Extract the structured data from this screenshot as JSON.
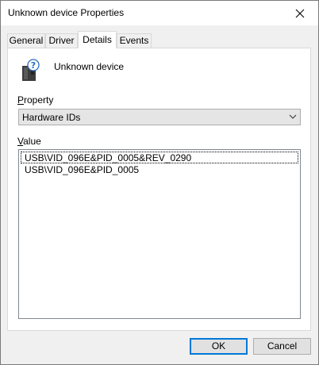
{
  "window": {
    "title": "Unknown device Properties"
  },
  "tabs": [
    {
      "label": "General"
    },
    {
      "label": "Driver"
    },
    {
      "label": "Details"
    },
    {
      "label": "Events"
    }
  ],
  "active_tab": "Details",
  "device": {
    "name": "Unknown device",
    "icon": "unknown-usb-device-icon"
  },
  "property": {
    "label_prefix": "",
    "label_underlined": "P",
    "label_rest": "roperty",
    "selected": "Hardware IDs"
  },
  "value": {
    "label_underlined": "V",
    "label_rest": "alue",
    "items": [
      "USB\\VID_096E&PID_0005&REV_0290",
      "USB\\VID_096E&PID_0005"
    ]
  },
  "buttons": {
    "ok": "OK",
    "cancel": "Cancel"
  },
  "colors": {
    "accent": "#0078d7",
    "dialog_bg": "#f0f0f0"
  }
}
